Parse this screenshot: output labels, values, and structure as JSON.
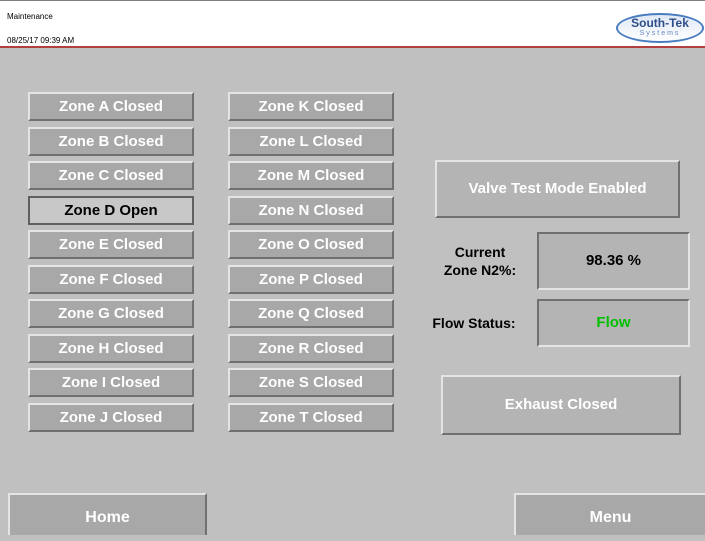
{
  "header": {
    "title": "Maintenance",
    "datetime": "08/25/17   09:39 AM",
    "logo_name": "South-Tek",
    "logo_sub": "Systems"
  },
  "zones_left": [
    "Zone A Closed",
    "Zone B Closed",
    "Zone C Closed",
    "Zone D Open",
    "Zone E Closed",
    "Zone F Closed",
    "Zone G Closed",
    "Zone H Closed",
    "Zone I Closed",
    "Zone J Closed"
  ],
  "zones_right": [
    "Zone K Closed",
    "Zone L Closed",
    "Zone M Closed",
    "Zone N Closed",
    "Zone O Closed",
    "Zone P Closed",
    "Zone Q Closed",
    "Zone R Closed",
    "Zone S Closed",
    "Zone T Closed"
  ],
  "valve_test": "Valve Test Mode Enabled",
  "n2": {
    "label_line1": "Current",
    "label_line2": "Zone N2%:",
    "value": "98.36 %"
  },
  "flow": {
    "label": "Flow Status:",
    "value": "Flow",
    "value_color": "#00c000"
  },
  "exhaust": "Exhaust Closed",
  "nav": {
    "home": "Home",
    "menu": "Menu"
  }
}
